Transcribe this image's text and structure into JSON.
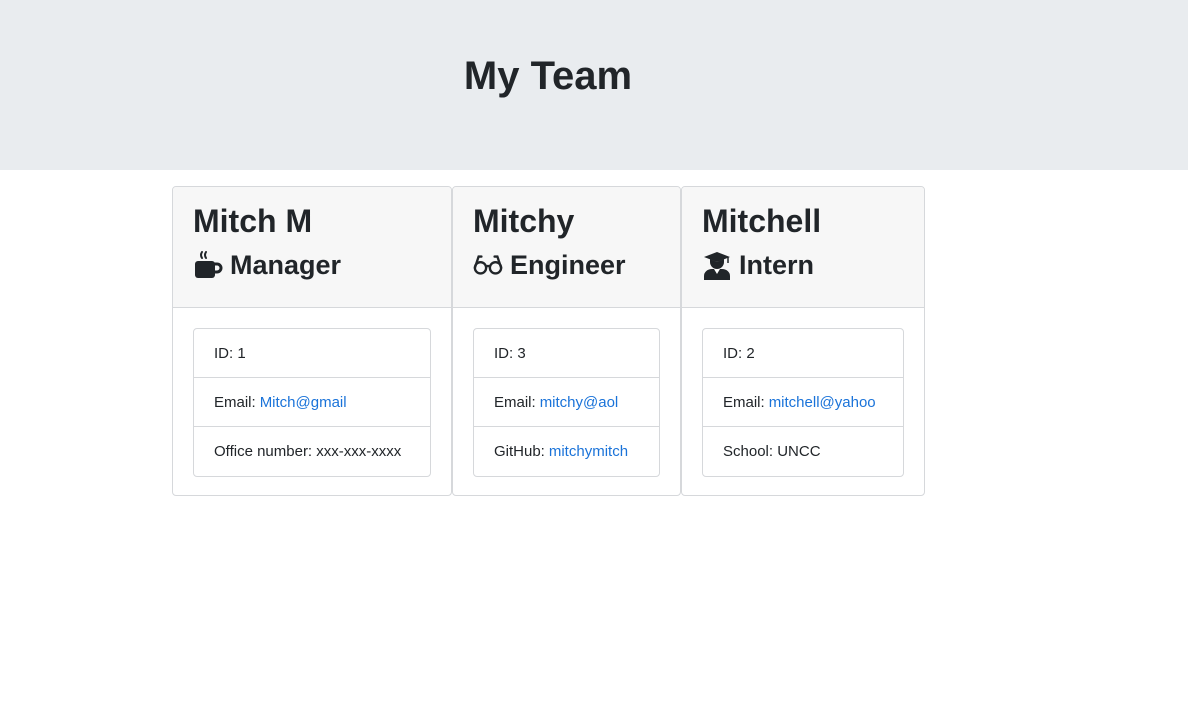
{
  "header": {
    "title": "My Team"
  },
  "team": [
    {
      "name": "Mitch M",
      "role": "Manager",
      "icon": "coffee-mug-icon",
      "id_label": "ID: 1",
      "email_prefix": "Email:",
      "email": "Mitch@gmail",
      "extra_label": "Office number: xxx-xxx-xxxx"
    },
    {
      "name": "Mitchy",
      "role": "Engineer",
      "icon": "glasses-icon",
      "id_label": "ID: 3",
      "email_prefix": "Email:",
      "email": "mitchy@aol",
      "extra_prefix": "GitHub:",
      "extra_link": "mitchymitch"
    },
    {
      "name": "Mitchell",
      "role": "Intern",
      "icon": "graduate-icon",
      "id_label": "ID: 2",
      "email_prefix": "Email:",
      "email": "mitchell@yahoo",
      "extra_label": "School: UNCC"
    }
  ],
  "colors": {
    "jumbotron_bg": "#e9ecef",
    "card_header_bg": "#f7f7f7",
    "link": "#1a73d9",
    "text": "#212529"
  }
}
